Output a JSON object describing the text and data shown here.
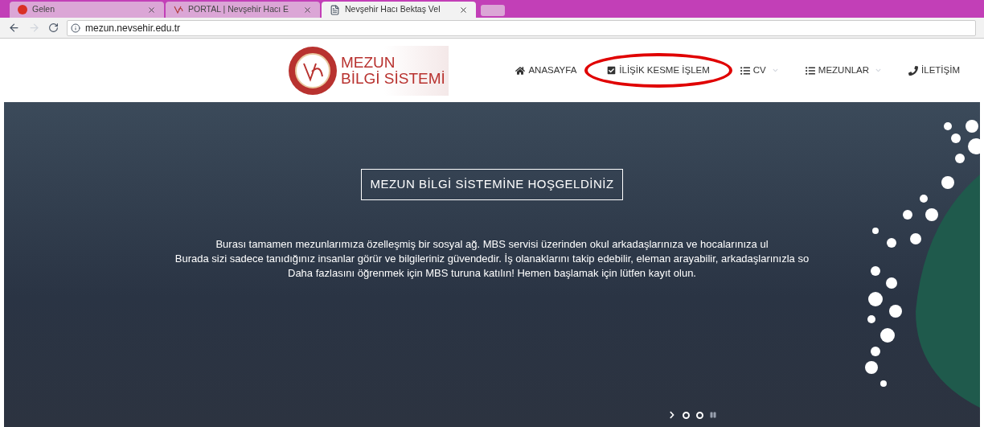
{
  "browser": {
    "tabs": [
      {
        "title": "Gelen",
        "selected": false,
        "kind": "mail"
      },
      {
        "title": "PORTAL | Nevşehir Hacı E",
        "selected": false,
        "kind": "logo"
      },
      {
        "title": "Nevşehir Hacı Bektaş Vel",
        "selected": true,
        "kind": "page"
      }
    ],
    "url": "mezun.nevsehir.edu.tr"
  },
  "header": {
    "logo_lines": [
      "MEZUN",
      "BİLGİ SİSTEMİ"
    ],
    "nav": [
      {
        "label": "ANASAYFA",
        "kind": "home",
        "dropdown": false,
        "highlighted": false
      },
      {
        "label": "İLİŞİK KESME İŞLEM",
        "kind": "check",
        "dropdown": false,
        "highlighted": true
      },
      {
        "label": "CV",
        "kind": "list",
        "dropdown": true,
        "highlighted": false
      },
      {
        "label": "MEZUNLAR",
        "kind": "list",
        "dropdown": true,
        "highlighted": false
      },
      {
        "label": "İLETİŞİM",
        "kind": "phone",
        "dropdown": false,
        "highlighted": false
      }
    ]
  },
  "hero": {
    "title": "MEZUN BİLGİ SİSTEMİNE HOŞGELDİNİZ",
    "lines": [
      "Burası tamamen mezunlarımıza özelleşmiş bir sosyal ağ. MBS servisi üzerinden okul arkadaşlarınıza ve hocalarınıza ul",
      "Burada sizi sadece tanıdığınız insanlar görür ve bilgileriniz güvendedir. İş olanaklarını takip edebilir, eleman arayabilir, arkadaşlarınızla so",
      "Daha fazlasını öğrenmek için MBS turuna katılın! Hemen başlamak için lütfen kayıt olun."
    ],
    "slide_dots": [
      {
        "kind": "dot"
      },
      {
        "kind": "dot"
      }
    ]
  }
}
